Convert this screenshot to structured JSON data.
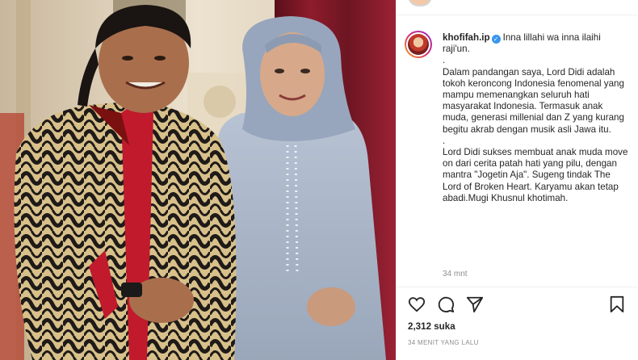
{
  "post": {
    "username": "khofifah.ip",
    "verified_icon": "verified-badge-icon",
    "caption": {
      "first_line": "Inna lillahi wa inna ilaihi raji'un.",
      "paragraphs": [
        ".",
        "Dalam pandangan saya, Lord Didi adalah tokoh keroncong Indonesia fenomenal yang mampu memenangkan seluruh hati masyarakat Indonesia. Termasuk anak muda, generasi millenial dan Z yang kurang begitu akrab dengan musik asli Jawa itu.",
        ".",
        "Lord Didi sukses membuat anak muda move on dari cerita patah hati yang pilu, dengan mantra \"Jogetin Aja\". Sugeng tindak The Lord of Broken Heart. Karyamu akan tetap abadi.Mugi Khusnul khotimah."
      ]
    },
    "caption_time": "34 mnt",
    "likes": "2,312 suka",
    "time_ago": "34 MENIT YANG LALU",
    "actions": [
      "heart-icon",
      "comment-icon",
      "share-icon",
      "bookmark-icon"
    ]
  },
  "colors": {
    "text": "#262626",
    "muted": "#8e8e8e",
    "verified": "#3897f0",
    "divider": "#efefef"
  }
}
